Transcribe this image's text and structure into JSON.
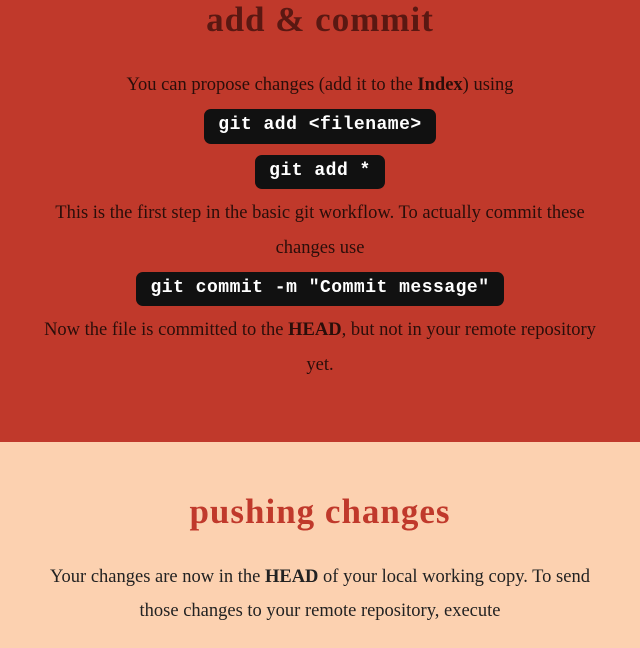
{
  "addCommit": {
    "title": "add & commit",
    "p1_pre": "You can propose changes (add it to the ",
    "p1_bold": "Index",
    "p1_post": ") using",
    "code1": "git add <filename>",
    "code2": "git add *",
    "p2": "This is the first step in the basic git workflow. To actually commit these changes use",
    "code3": "git commit -m \"Commit message\"",
    "p3_pre": "Now the file is committed to the ",
    "p3_bold": "HEAD",
    "p3_post": ", but not in your remote repository yet."
  },
  "pushing": {
    "title": "pushing changes",
    "p1_pre": "Your changes are now in the ",
    "p1_bold": "HEAD",
    "p1_post": " of your local working copy. To send those changes to your remote repository, execute"
  }
}
